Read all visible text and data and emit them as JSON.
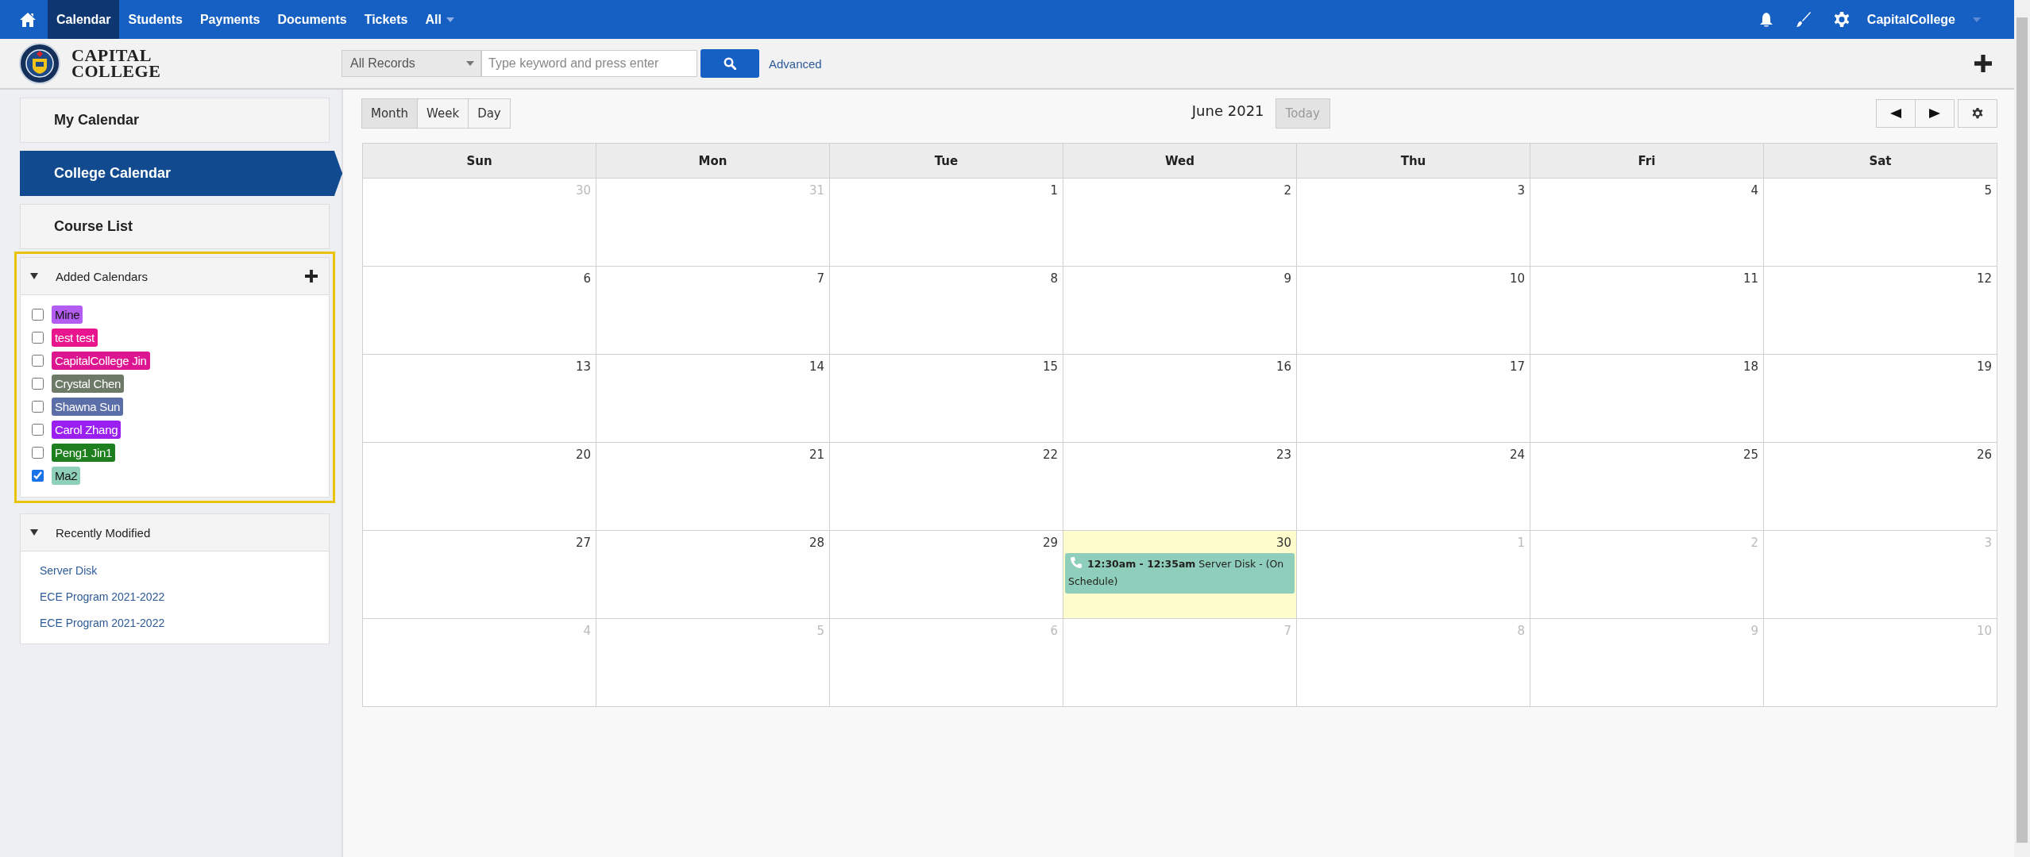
{
  "top_nav": {
    "items": [
      {
        "label": "Calendar",
        "selected": true
      },
      {
        "label": "Students",
        "selected": false
      },
      {
        "label": "Payments",
        "selected": false
      },
      {
        "label": "Documents",
        "selected": false
      },
      {
        "label": "Tickets",
        "selected": false
      }
    ],
    "more": {
      "label": "All"
    },
    "user": {
      "label": "CapitalCollege"
    }
  },
  "header": {
    "logo_lines": [
      "CAPITAL",
      "COLLEGE"
    ],
    "search_scope": "All Records",
    "search": {
      "placeholder": "Type keyword and press enter"
    },
    "advanced_link": "Advanced"
  },
  "sidebar": {
    "items": [
      {
        "label": "My Calendar",
        "selected": false
      },
      {
        "label": "College Calendar",
        "selected": true
      },
      {
        "label": "Course List",
        "selected": false
      }
    ],
    "added_calendars": {
      "title": "Added Calendars",
      "highlighted": true,
      "expanded": true,
      "items": [
        {
          "label": "Mine",
          "color": "#b35cf2",
          "checked": false
        },
        {
          "label": "test test",
          "color": "#e8158e",
          "checked": false
        },
        {
          "label": "CapitalCollege Jin",
          "color": "#de1590",
          "checked": false
        },
        {
          "label": "Crystal Chen",
          "color": "#6e7a68",
          "checked": false
        },
        {
          "label": "Shawna Sun",
          "color": "#5b6ea8",
          "checked": false
        },
        {
          "label": "Carol Zhang",
          "color": "#9a1ff0",
          "checked": false
        },
        {
          "label": "Peng1 Jin1",
          "color": "#1d7f1d",
          "checked": false
        },
        {
          "label": "Ma2",
          "color": "#8fd0bb",
          "checked": true
        }
      ]
    },
    "recently_modified": {
      "title": "Recently Modified",
      "expanded": true,
      "links": [
        "Server Disk",
        "ECE Program 2021-2022",
        "ECE Program 2021-2022"
      ]
    }
  },
  "calendar": {
    "views": [
      {
        "label": "Month",
        "selected": true
      },
      {
        "label": "Week",
        "selected": false
      },
      {
        "label": "Day",
        "selected": false
      }
    ],
    "title": "June 2021",
    "today_button": {
      "label": "Today",
      "disabled": true
    },
    "weekdays": [
      "Sun",
      "Mon",
      "Tue",
      "Wed",
      "Thu",
      "Fri",
      "Sat"
    ],
    "weeks": [
      [
        {
          "day": "30",
          "other_month": true
        },
        {
          "day": "31",
          "other_month": true
        },
        {
          "day": "1",
          "other_month": false
        },
        {
          "day": "2",
          "other_month": false
        },
        {
          "day": "3",
          "other_month": false
        },
        {
          "day": "4",
          "other_month": false
        },
        {
          "day": "5",
          "other_month": false
        }
      ],
      [
        {
          "day": "6",
          "other_month": false
        },
        {
          "day": "7",
          "other_month": false
        },
        {
          "day": "8",
          "other_month": false
        },
        {
          "day": "9",
          "other_month": false
        },
        {
          "day": "10",
          "other_month": false
        },
        {
          "day": "11",
          "other_month": false
        },
        {
          "day": "12",
          "other_month": false
        }
      ],
      [
        {
          "day": "13",
          "other_month": false
        },
        {
          "day": "14",
          "other_month": false
        },
        {
          "day": "15",
          "other_month": false
        },
        {
          "day": "16",
          "other_month": false
        },
        {
          "day": "17",
          "other_month": false
        },
        {
          "day": "18",
          "other_month": false
        },
        {
          "day": "19",
          "other_month": false
        }
      ],
      [
        {
          "day": "20",
          "other_month": false
        },
        {
          "day": "21",
          "other_month": false
        },
        {
          "day": "22",
          "other_month": false
        },
        {
          "day": "23",
          "other_month": false
        },
        {
          "day": "24",
          "other_month": false
        },
        {
          "day": "25",
          "other_month": false
        },
        {
          "day": "26",
          "other_month": false
        }
      ],
      [
        {
          "day": "27",
          "other_month": false
        },
        {
          "day": "28",
          "other_month": false
        },
        {
          "day": "29",
          "other_month": false
        },
        {
          "day": "30",
          "other_month": false,
          "today": true,
          "events": [
            {
              "time": "12:30am - 12:35am",
              "title": "Server Disk - (On Schedule)",
              "color": "#8fceba"
            }
          ]
        },
        {
          "day": "1",
          "other_month": true
        },
        {
          "day": "2",
          "other_month": true
        },
        {
          "day": "3",
          "other_month": true
        }
      ],
      [
        {
          "day": "4",
          "other_month": true
        },
        {
          "day": "5",
          "other_month": true
        },
        {
          "day": "6",
          "other_month": true
        },
        {
          "day": "7",
          "other_month": true
        },
        {
          "day": "8",
          "other_month": true
        },
        {
          "day": "9",
          "other_month": true
        },
        {
          "day": "10",
          "other_month": true
        }
      ]
    ]
  }
}
